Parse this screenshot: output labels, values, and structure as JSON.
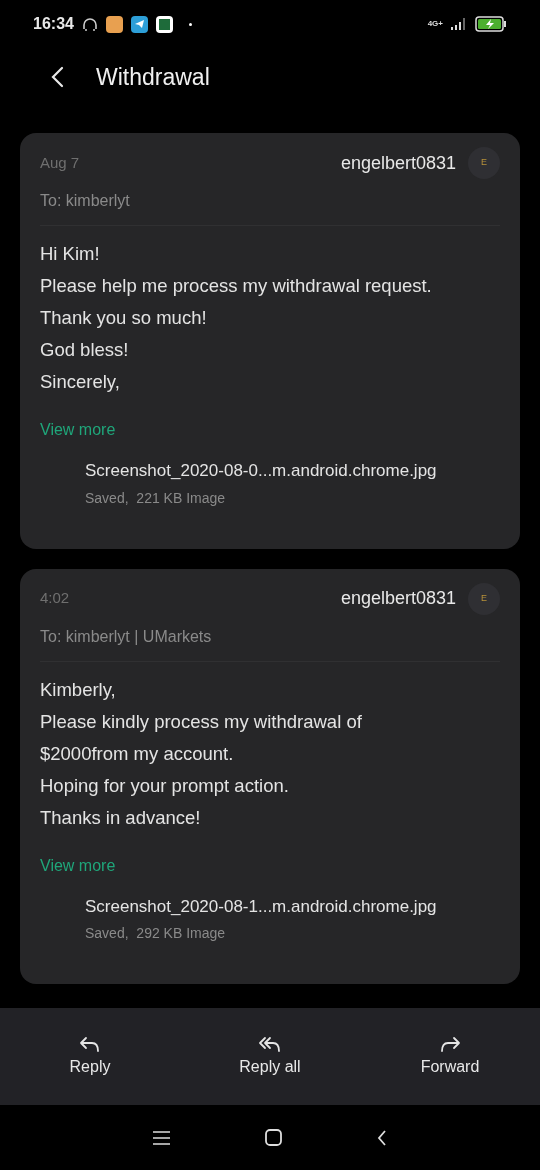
{
  "status_bar": {
    "time": "16:34",
    "network": "4G+"
  },
  "header": {
    "title": "Withdrawal"
  },
  "messages": [
    {
      "date": "Aug 7",
      "sender": "engelbert0831",
      "avatar_letter": "E",
      "to": "To: kimberlyt",
      "body": [
        "Hi Kim!",
        "Please help me process my withdrawal request.",
        "Thank you so much!",
        "God bless!",
        "Sincerely,"
      ],
      "view_more": "View more",
      "attachment": {
        "name": "Screenshot_2020-08-0...m.android.chrome.jpg",
        "info": "Saved,  221 KB Image"
      }
    },
    {
      "date": "4:02",
      "sender": "engelbert0831",
      "avatar_letter": "E",
      "to": "To: kimberlyt | UMarkets",
      "body": [
        "Kimberly,",
        "Please kindly process my withdrawal of",
        "$2000from my account.",
        "Hoping for your prompt action.",
        "Thanks in advance!"
      ],
      "view_more": "View more",
      "attachment": {
        "name": "Screenshot_2020-08-1...m.android.chrome.jpg",
        "info": "Saved,  292 KB Image"
      }
    }
  ],
  "actions": [
    {
      "kind": "reply",
      "label": "Reply"
    },
    {
      "kind": "reply_all",
      "label": "Reply all"
    },
    {
      "kind": "forward",
      "label": "Forward"
    }
  ]
}
